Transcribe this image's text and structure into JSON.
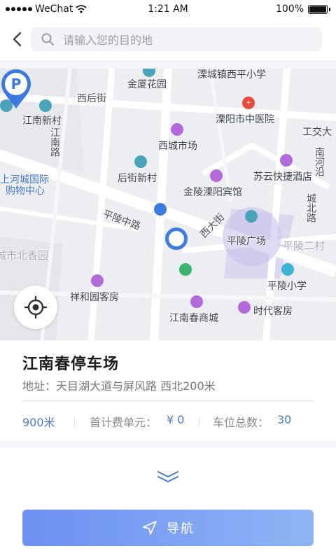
{
  "status_bar": {
    "carrier": "WeChat",
    "time": "1:21 AM",
    "battery": "100%"
  },
  "header": {
    "search_placeholder": "请输入您的目的地"
  },
  "map": {
    "labels": {
      "jinsha": "金厦花园",
      "liyang_school": "溧城镇西平小学",
      "xihou": "西后街",
      "hospital": "溧阳市中医院",
      "jiangnan_village": "江南新村",
      "jiangnan_road": "江南路",
      "xicheng_market": "西城市场",
      "icbc": "工交大",
      "nanhe": "南河沿",
      "houxin": "后街新村",
      "suyun": "苏云快捷酒店",
      "shanghe": "上河城国际",
      "shopping": "购物中心",
      "jinling_hotel": "金陵溧阳宾馆",
      "chengbei": "城北路",
      "pingling_road": "平陵中路",
      "xidajie": "西大街",
      "pingling_square": "平陵广场",
      "pingling_er": "平陵二村",
      "beixiang": "城市北香园",
      "pingling_school": "平陵小学",
      "xiangheyuan": "祥和园客房",
      "jiangnan_chun": "江南春商城",
      "shidai": "时代客房"
    }
  },
  "card": {
    "title": "江南春停车场",
    "address": "地址：天目湖大道与屏风路 西北200米",
    "distance": "900米",
    "fee_label": "首计费单元：",
    "fee_value": "¥ 0",
    "spaces_label": "车位总数：",
    "spaces_value": "30"
  },
  "navigation": {
    "button_label": "导航"
  },
  "colors": {
    "accent": "#4b7ad0",
    "nav_gradient_start": "#6d8ff1",
    "nav_gradient_end": "#8fb4f5"
  }
}
